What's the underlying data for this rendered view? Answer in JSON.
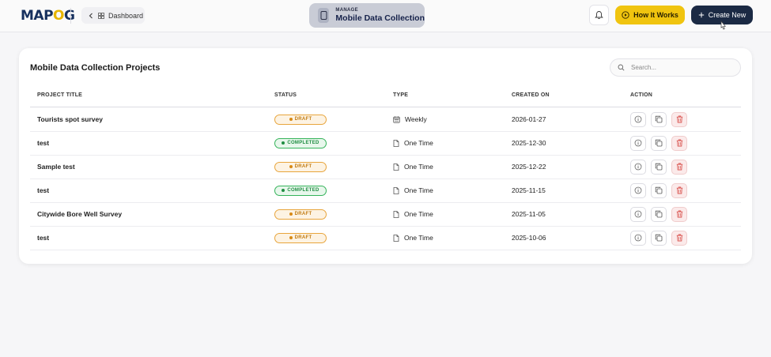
{
  "header": {
    "logo_left": "MAP",
    "logo_mid": "O",
    "logo_right": "G",
    "back_label": "Dashboard",
    "manage_sub": "MANAGE",
    "manage_title": "Mobile Data Collection",
    "how_label": "How It Works",
    "create_label": "Create New"
  },
  "card": {
    "title": "Mobile Data Collection Projects",
    "search_placeholder": "Search..."
  },
  "columns": [
    "PROJECT TITLE",
    "STATUS",
    "TYPE",
    "CREATED ON",
    "ACTION"
  ],
  "rows": [
    {
      "title": "Tourists spot survey",
      "status": "DRAFT",
      "type": "Weekly",
      "created": "2026-01-27"
    },
    {
      "title": "test",
      "status": "COMPLETED",
      "type": "One Time",
      "created": "2025-12-30"
    },
    {
      "title": "Sample test",
      "status": "DRAFT",
      "type": "One Time",
      "created": "2025-12-22"
    },
    {
      "title": "test",
      "status": "COMPLETED",
      "type": "One Time",
      "created": "2025-11-15"
    },
    {
      "title": "Citywide Bore Well Survey",
      "status": "DRAFT",
      "type": "One Time",
      "created": "2025-11-05"
    },
    {
      "title": "test",
      "status": "DRAFT",
      "type": "One Time",
      "created": "2025-10-06"
    }
  ],
  "colors": {
    "accent_yellow": "#f0c40f",
    "primary_dark": "#1b2a44",
    "draft": "#d88a16",
    "completed": "#1f8d42",
    "delete": "#d9534f"
  },
  "icons": {
    "back": "chevron-left-icon",
    "dashboard": "grid-icon",
    "manage": "phone-icon",
    "bell": "bell-icon",
    "how": "play-circle-icon",
    "create": "plus-icon",
    "search": "search-icon",
    "weekly": "calendar-icon",
    "one_time": "file-icon",
    "info": "info-icon",
    "copy": "copy-icon",
    "delete": "trash-icon"
  }
}
